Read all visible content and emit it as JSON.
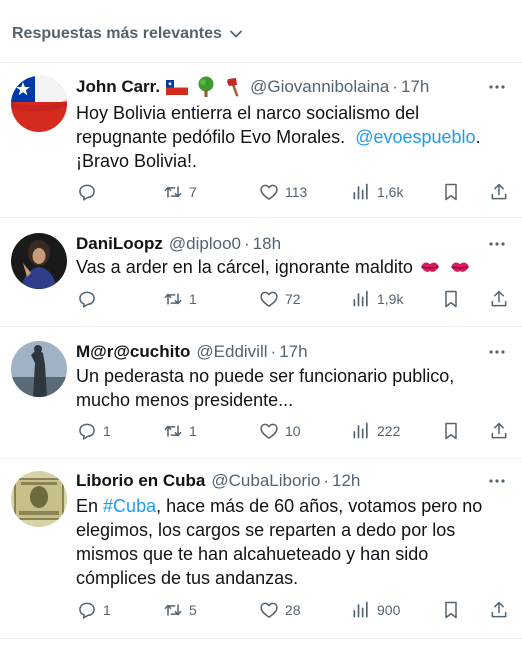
{
  "sort_header": {
    "label": "Respuestas más relevantes",
    "icon": "chevron-down-icon"
  },
  "colors": {
    "text": "#0f1419",
    "secondary": "#536471",
    "link": "#1d9bf0",
    "divider": "#eff3f4",
    "lips": "#d81b60"
  },
  "replies": [
    {
      "display_name": "John Carr.",
      "extras": [
        "chile-flag-emoji",
        "tree-emoji",
        "axe-emoji"
      ],
      "handle": "@Giovannibolaina",
      "separator": "·",
      "time": "17h",
      "text": {
        "line1": "Hoy Bolivia entierra el narco socialismo del",
        "line2_before": "repugnante pedófilo Evo Morales.",
        "mention": "@evoespueblo",
        "line2_after": ".",
        "line3": "¡Bravo Bolivia!."
      },
      "stats": {
        "replies": "",
        "retweets": "7",
        "likes": "113",
        "views": "1,6k"
      }
    },
    {
      "display_name": "DaniLoopz",
      "handle": "@diploo0",
      "separator": "·",
      "time": "18h",
      "text": {
        "line1": "Vas a arder en la cárcel, ignorante maldito",
        "emoji": "kiss-mark-emoji"
      },
      "stats": {
        "replies": "",
        "retweets": "1",
        "likes": "72",
        "views": "1,9k"
      }
    },
    {
      "display_name": "M@r@cuchito",
      "handle": "@Eddivill",
      "separator": "·",
      "time": "17h",
      "text": {
        "line1": "Un pederasta no puede ser funcionario publico,",
        "line2": "mucho menos presidente..."
      },
      "stats": {
        "replies": "1",
        "retweets": "1",
        "likes": "10",
        "views": "222"
      }
    },
    {
      "display_name": "Liborio en Cuba",
      "handle": "@CubaLiborio",
      "separator": "·",
      "time": "12h",
      "text": {
        "prefix": "En",
        "hashtag": "#Cuba",
        "line1_after": ", hace más de 60 años, votamos pero no",
        "line2": "elegimos, los cargos se reparten a dedo por los",
        "line3": "mismos que te han alcahueteado y han sido",
        "line4": "cómplices de tus andanzas."
      },
      "stats": {
        "replies": "1",
        "retweets": "5",
        "likes": "28",
        "views": "900"
      }
    }
  ]
}
